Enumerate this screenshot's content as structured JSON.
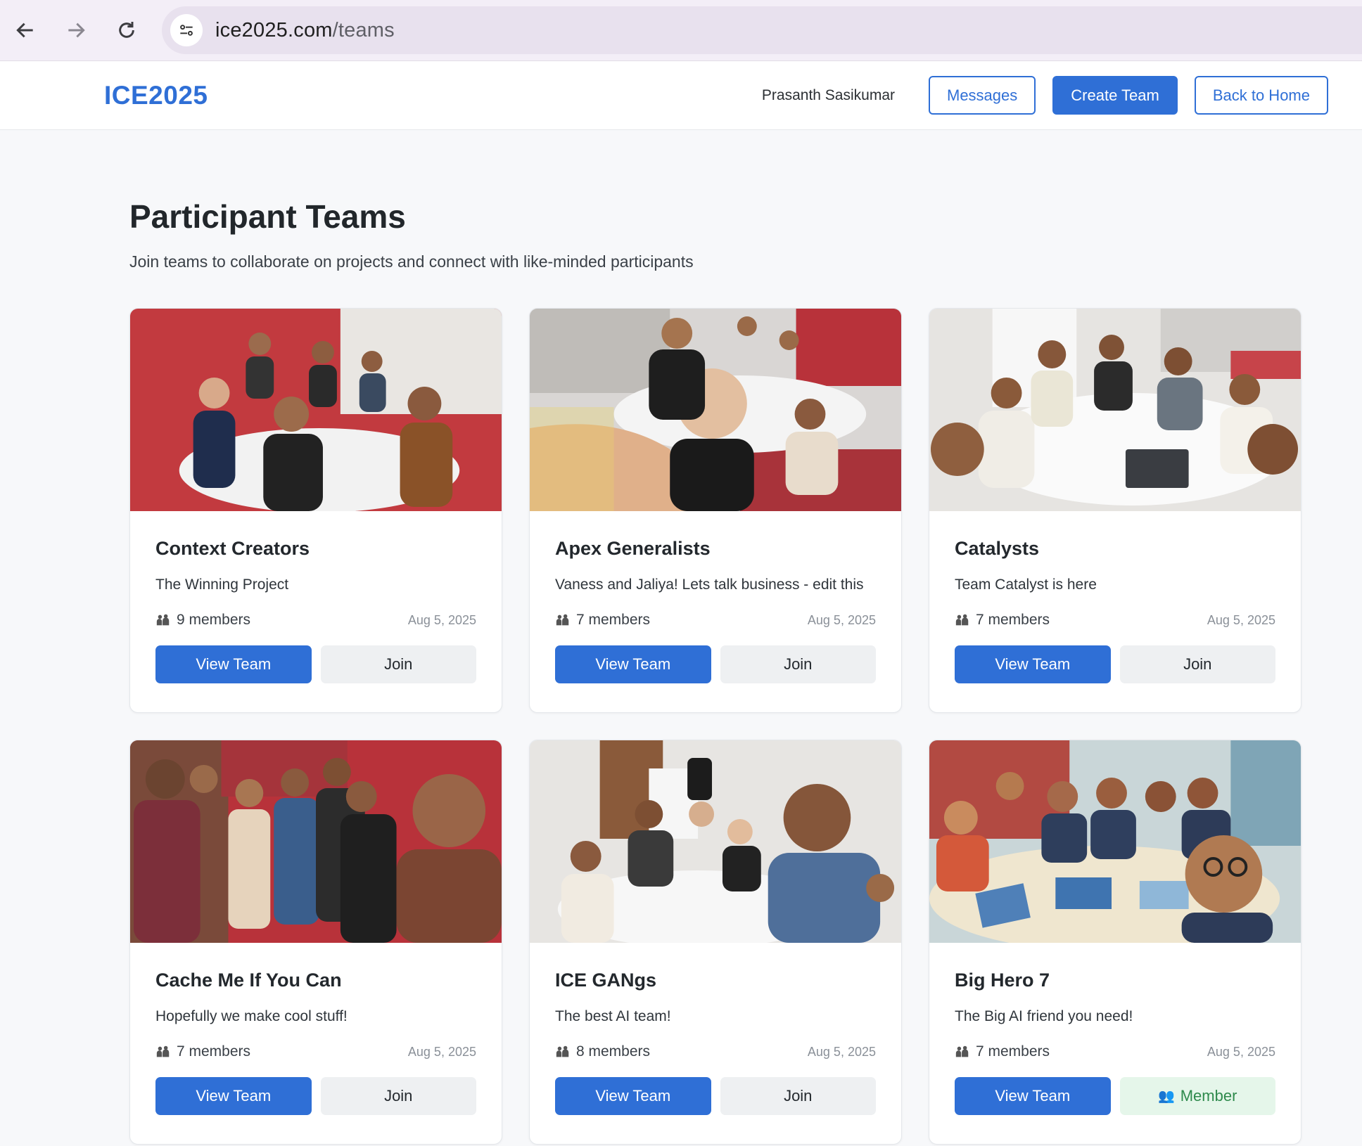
{
  "browser": {
    "url_host": "ice2025.com",
    "url_path": "/teams"
  },
  "header": {
    "brand": "ICE2025",
    "user_name": "Prasanth Sasikumar",
    "messages_label": "Messages",
    "create_label": "Create Team",
    "home_label": "Back to Home"
  },
  "page": {
    "title": "Participant Teams",
    "subtitle": "Join teams to collaborate on projects and connect with like-minded participants"
  },
  "teams": [
    {
      "name": "Context Creators",
      "desc": "The Winning Project",
      "members": "9 members",
      "date": "Aug 5, 2025",
      "view_label": "View Team",
      "action_label": "Join"
    },
    {
      "name": "Apex Generalists",
      "desc": "Vaness and Jaliya! Lets talk business - edit this",
      "members": "7 members",
      "date": "Aug 5, 2025",
      "view_label": "View Team",
      "action_label": "Join"
    },
    {
      "name": "Catalysts",
      "desc": "Team Catalyst is here",
      "members": "7 members",
      "date": "Aug 5, 2025",
      "view_label": "View Team",
      "action_label": "Join"
    },
    {
      "name": "Cache Me If You Can",
      "desc": "Hopefully we make cool stuff!",
      "members": "7 members",
      "date": "Aug 5, 2025",
      "view_label": "View Team",
      "action_label": "Join"
    },
    {
      "name": "ICE GANgs",
      "desc": "The best AI team!",
      "members": "8 members",
      "date": "Aug 5, 2025",
      "view_label": "View Team",
      "action_label": "Join"
    },
    {
      "name": "Big Hero 7",
      "desc": "The Big AI friend you need!",
      "members": "7 members",
      "date": "Aug 5, 2025",
      "view_label": "View Team",
      "action_label": "Member"
    }
  ],
  "colors": {
    "accent": "#2f6fd6",
    "member_bg": "#e5f6ea",
    "member_text": "#2e8a4c"
  }
}
